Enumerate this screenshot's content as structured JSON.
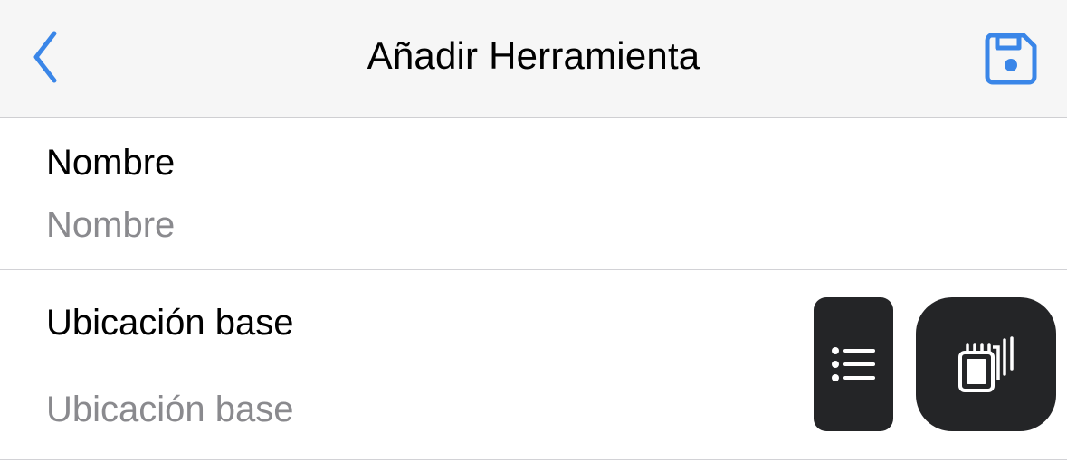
{
  "navbar": {
    "title": "Añadir Herramienta",
    "back_icon": "chevron-left-icon",
    "save_icon": "floppy-disk-icon",
    "accent_color": "#3a86e8"
  },
  "form": {
    "fields": [
      {
        "label": "Nombre",
        "placeholder": "Nombre"
      },
      {
        "label": "Ubicación base",
        "placeholder": "Ubicación base"
      }
    ]
  },
  "floating_buttons": {
    "list_icon": "list-icon",
    "cards_icon": "cards-stack-icon",
    "background_color": "#242527"
  }
}
